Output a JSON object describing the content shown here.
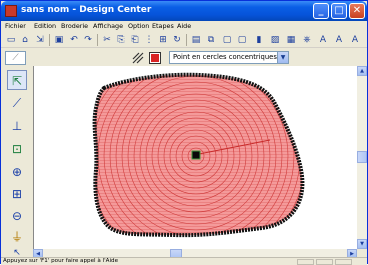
{
  "window": {
    "title": "sans nom - Design Center"
  },
  "title_buttons": {
    "minimize": "_",
    "maximize": "□",
    "close": "✕"
  },
  "menu": [
    "Fichier",
    "Edition",
    "Broderie",
    "Affichage",
    "Option",
    "Etapes",
    "Aide"
  ],
  "toolbar_icons": [
    "new-icon",
    "open-icon",
    "import-icon",
    "save-icon",
    "undo-icon",
    "redo-icon",
    "cut-icon",
    "copy-icon",
    "paste-icon",
    "grid-icon",
    "align-icon",
    "rotate-icon",
    "view-icon",
    "layout-icon",
    "monitor-icon",
    "chart-icon",
    "wizard-icon",
    "stitch-icon",
    "preview-icon",
    "font-icon"
  ],
  "secondary_toolbar": {
    "fill_pattern_label": "Point en cercles concentriques",
    "line_color": "#000000",
    "fill_color": "#d92424"
  },
  "left_tools": [
    {
      "name": "select-tool",
      "glyph": "⇱"
    },
    {
      "name": "line-tool",
      "glyph": "⟋"
    },
    {
      "name": "point-tool",
      "glyph": "⊥"
    },
    {
      "name": "pan-tool",
      "glyph": "⊡"
    },
    {
      "name": "zoom-in-tool",
      "glyph": "⊕"
    },
    {
      "name": "zoom-fit-tool",
      "glyph": "⊞"
    },
    {
      "name": "zoom-out-tool",
      "glyph": "⊖"
    },
    {
      "name": "fill-tool",
      "glyph": "⏚"
    },
    {
      "name": "edit-point-tool",
      "glyph": "↖"
    }
  ],
  "canvas": {
    "shape_fill": "#f49a9a",
    "stitch_color": "#c82a2a",
    "border_color": "#111111"
  },
  "status": {
    "text": "Appuyez sur 'F1' pour faire appel à l'Aide"
  }
}
